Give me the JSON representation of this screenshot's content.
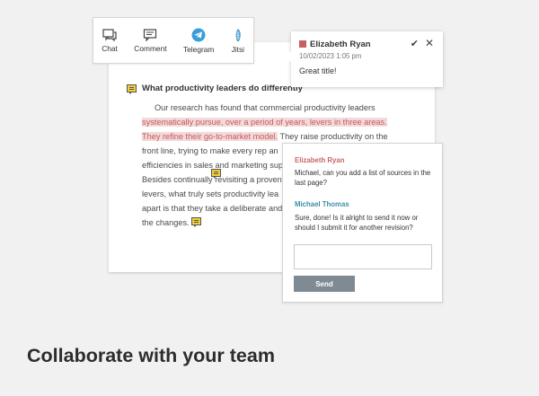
{
  "toolbar": {
    "items": [
      {
        "label": "Chat",
        "icon": "chat-icon"
      },
      {
        "label": "Comment",
        "icon": "comment-icon"
      },
      {
        "label": "Telegram",
        "icon": "telegram-icon"
      },
      {
        "label": "Jitsi",
        "icon": "jitsi-icon"
      }
    ]
  },
  "document": {
    "heading": "What productivity leaders do differently",
    "lines": [
      "Our research has found that commercial productivity leaders",
      "systematically pursue, over a period of years, levers in three areas.",
      "They refine their go-to-market model.",
      " They raise productivity on the",
      "front line, trying to make every rep an",
      "efficiencies in sales and marketing sup",
      "Besides continually revisiting a proven",
      "levers, what truly sets productivity lea",
      "apart is that they take a deliberate and",
      "the changes."
    ]
  },
  "popup": {
    "author": "Elizabeth Ryan",
    "timestamp": "10/02/2023 1:05 pm",
    "text": "Great title!",
    "check": "✔",
    "close": "✕"
  },
  "thread": {
    "comments": [
      {
        "author": "Elizabeth Ryan",
        "text": "Michael, can you add a list of sources in the last page?"
      },
      {
        "author": "Michael Thomas",
        "text": "Sure, done! Is it alright to send it now or should I submit it for another revision?"
      }
    ],
    "reply_placeholder": "",
    "send_label": "Send"
  },
  "headline": "Collaborate with your team",
  "colors": {
    "highlight": "#f3dada",
    "highlight_text": "#c65a5a",
    "author1": "#c96565",
    "author2": "#3d8fa8",
    "send_button": "#7f8a93",
    "comment_marker": "#f2cf3a"
  }
}
